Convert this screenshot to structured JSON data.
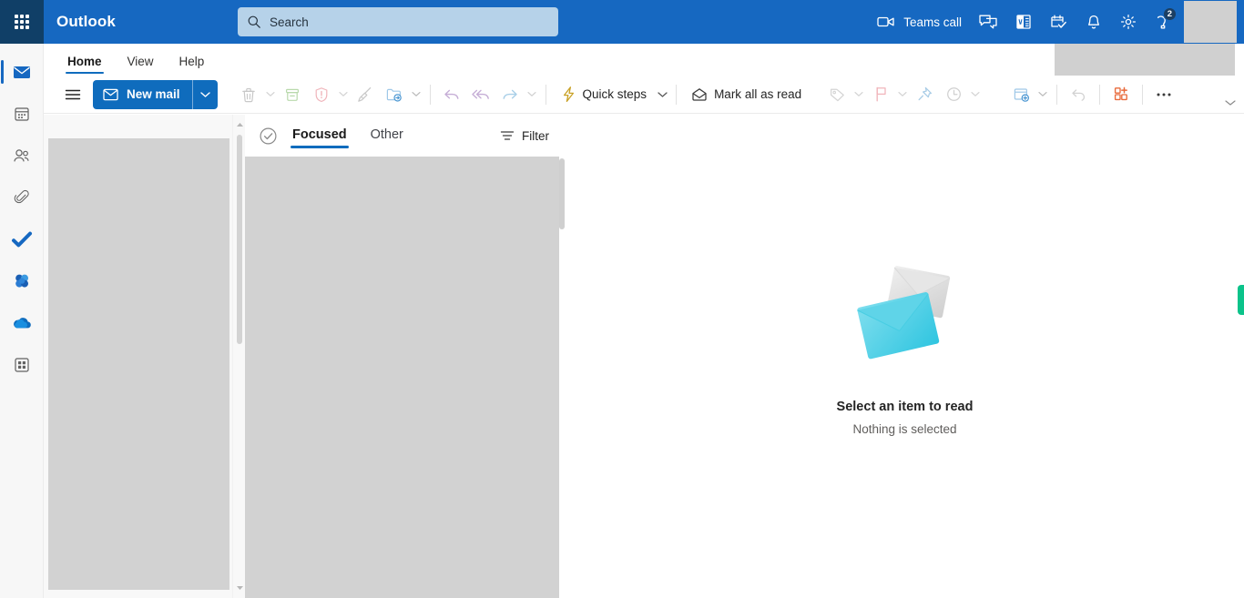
{
  "header": {
    "brand": "Outlook",
    "waffle_name": "app-launcher",
    "search": {
      "placeholder": "Search",
      "value": ""
    },
    "teams_call_label": "Teams call",
    "notifications_badge": "2",
    "icons": [
      "waffle-icon",
      "search-icon",
      "video-camera-icon",
      "chat-icon",
      "m365-apps-icon",
      "calendar-check-icon",
      "bell-icon",
      "gear-icon",
      "help-support-icon"
    ],
    "colors": {
      "bar": "#1668c1",
      "waffle_bg": "#103f67",
      "search_bg": "#b6d2e9"
    }
  },
  "rail": {
    "items": [
      {
        "name": "mail",
        "icon": "mail-icon",
        "active": true
      },
      {
        "name": "calendar",
        "icon": "calendar-icon",
        "active": false
      },
      {
        "name": "people",
        "icon": "people-icon",
        "active": false
      },
      {
        "name": "files",
        "icon": "paperclip-icon",
        "active": false
      },
      {
        "name": "to-do",
        "icon": "checkmark-icon",
        "active": false
      },
      {
        "name": "viva-engage",
        "icon": "viva-flower-icon",
        "active": false
      },
      {
        "name": "onedrive",
        "icon": "cloud-icon",
        "active": false
      },
      {
        "name": "more-apps",
        "icon": "apps-grid-icon",
        "active": false
      }
    ]
  },
  "ribbon": {
    "tabs": [
      {
        "label": "Home",
        "active": true
      },
      {
        "label": "View",
        "active": false
      },
      {
        "label": "Help",
        "active": false
      }
    ],
    "toolbar": {
      "hamburger": "menu-icon",
      "new_mail": "New mail",
      "delete": "delete-icon",
      "archive": "archive-icon",
      "report": "report-shield-icon",
      "sweep": "sweep-broom-icon",
      "move_to": "move-to-folder-icon",
      "reply": "reply-icon",
      "reply_all": "reply-all-icon",
      "forward": "forward-icon",
      "quick_steps": "Quick steps",
      "mark_all_read": "Mark all as read",
      "categorize": "tag-icon",
      "flag": "flag-icon",
      "pin": "pin-icon",
      "snooze": "clock-icon",
      "rules": "rules-icon",
      "undo": "undo-icon",
      "add_ins": "add-ins-icon",
      "more": "•••"
    }
  },
  "message_list": {
    "select_all_icon": "circle-check-icon",
    "pivots": [
      {
        "label": "Focused",
        "active": true
      },
      {
        "label": "Other",
        "active": false
      }
    ],
    "filter_label": "Filter",
    "filter_icon": "filter-icon"
  },
  "reading_pane": {
    "illustration": "two-envelopes-illustration",
    "title": "Select an item to read",
    "subtitle": "Nothing is selected"
  },
  "feedback_tab": {
    "name": "feedback-tab",
    "color": "#0bc38a"
  }
}
